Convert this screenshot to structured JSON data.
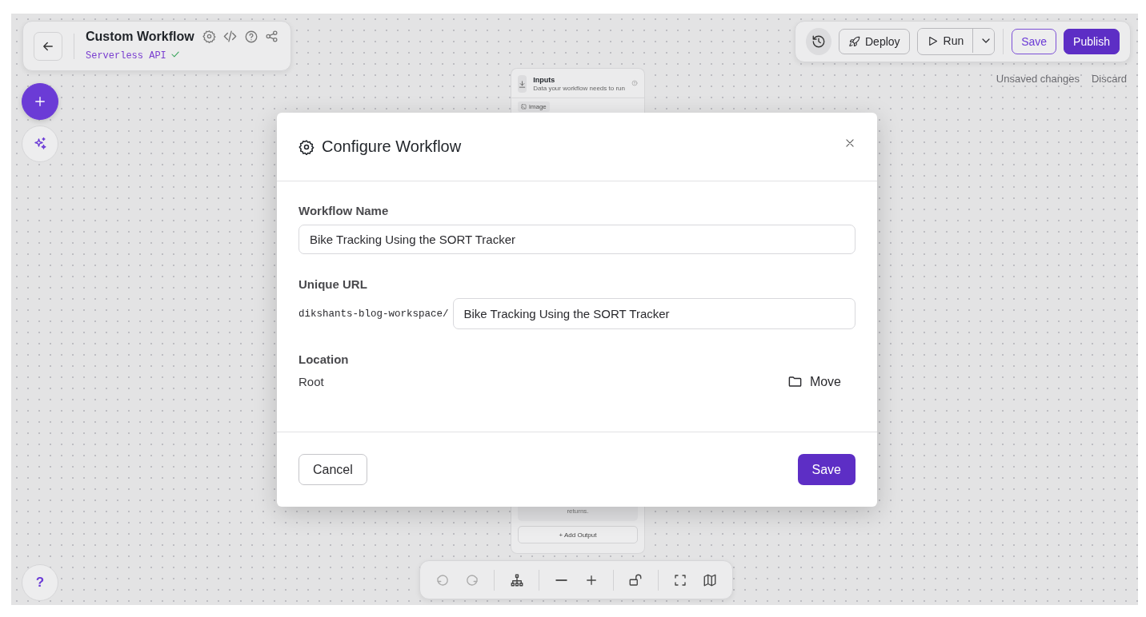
{
  "header": {
    "title": "Custom Workflow",
    "subtitle": "Serverless API"
  },
  "toolbar": {
    "deploy": "Deploy",
    "run": "Run",
    "save": "Save",
    "publish": "Publish"
  },
  "status": {
    "message": "Unsaved changes",
    "discard": "Discard"
  },
  "node": {
    "title": "Inputs",
    "description": "Data your workflow needs to run",
    "input_chip": "image",
    "footer_text": "returns.",
    "add_button": "+ Add Output"
  },
  "help_label": "?",
  "canvas_controls": {
    "undo": {
      "disabled": true
    },
    "redo": {
      "disabled": true
    }
  },
  "dialog": {
    "title": "Configure Workflow",
    "name_label": "Workflow Name",
    "name_value": "Bike Tracking Using the SORT Tracker",
    "url_label": "Unique URL",
    "url_prefix": "dikshants-blog-workspace/",
    "url_value": "Bike Tracking Using the SORT Tracker",
    "location_label": "Location",
    "location_value": "Root",
    "move_button": "Move",
    "cancel_button": "Cancel",
    "save_button": "Save"
  }
}
